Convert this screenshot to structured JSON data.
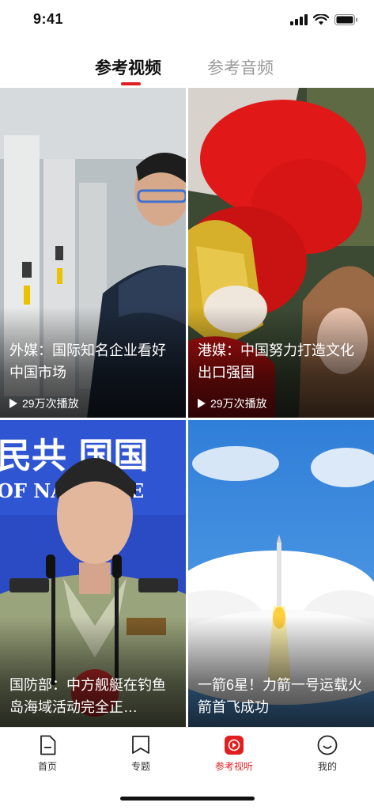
{
  "status_bar": {
    "time": "9:41"
  },
  "tabs": [
    {
      "label": "参考视频",
      "active": true
    },
    {
      "label": "参考音频",
      "active": false
    }
  ],
  "videos": [
    {
      "title": "外媒：国际知名企业看好中国市场",
      "plays": "29万次播放"
    },
    {
      "title": "港媒：中国努力打造文化出口强国",
      "plays": "29万次播放"
    },
    {
      "title": "国防部：中方舰艇在钓鱼岛海域活动完全正…",
      "plays": ""
    },
    {
      "title": "一箭6星！力箭一号运载火箭首飞成功",
      "plays": ""
    }
  ],
  "photo_text": {
    "sign_cn": "民共 国国",
    "sign_en": "OF NAT DEFE"
  },
  "bottom_nav": [
    {
      "label": "首页",
      "icon": "document-icon"
    },
    {
      "label": "专题",
      "icon": "bookmark-icon"
    },
    {
      "label": "参考视听",
      "icon": "play-icon",
      "active": true
    },
    {
      "label": "我的",
      "icon": "smile-icon"
    }
  ],
  "colors": {
    "accent": "#e02020"
  }
}
